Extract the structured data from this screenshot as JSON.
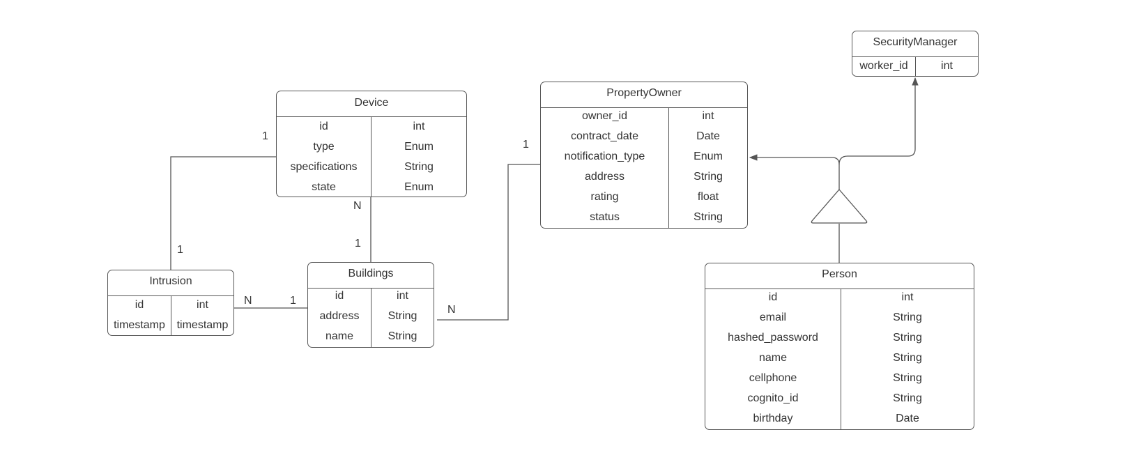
{
  "diagram": {
    "type": "entity-relationship",
    "line_color": "#555555",
    "text_color": "#333333",
    "entities": {
      "device": {
        "name": "Device",
        "attributes": [
          {
            "name": "id",
            "type": "int"
          },
          {
            "name": "type",
            "type": "Enum"
          },
          {
            "name": "specifications",
            "type": "String"
          },
          {
            "name": "state",
            "type": "Enum"
          }
        ]
      },
      "intrusion": {
        "name": "Intrusion",
        "attributes": [
          {
            "name": "id",
            "type": "int"
          },
          {
            "name": "timestamp",
            "type": "timestamp"
          }
        ]
      },
      "buildings": {
        "name": "Buildings",
        "attributes": [
          {
            "name": "id",
            "type": "int"
          },
          {
            "name": "address",
            "type": "String"
          },
          {
            "name": "name",
            "type": "String"
          }
        ]
      },
      "property_owner": {
        "name": "PropertyOwner",
        "attributes": [
          {
            "name": "owner_id",
            "type": "int"
          },
          {
            "name": "contract_date",
            "type": "Date"
          },
          {
            "name": "notification_type",
            "type": "Enum"
          },
          {
            "name": "address",
            "type": "String"
          },
          {
            "name": "rating",
            "type": "float"
          },
          {
            "name": "status",
            "type": "String"
          }
        ]
      },
      "security_manager": {
        "name": "SecurityManager",
        "attributes": [
          {
            "name": "worker_id",
            "type": "int"
          }
        ]
      },
      "person": {
        "name": "Person",
        "attributes": [
          {
            "name": "id",
            "type": "int"
          },
          {
            "name": "email",
            "type": "String"
          },
          {
            "name": "hashed_password",
            "type": "String"
          },
          {
            "name": "name",
            "type": "String"
          },
          {
            "name": "cellphone",
            "type": "String"
          },
          {
            "name": "cognito_id",
            "type": "String"
          },
          {
            "name": "birthday",
            "type": "Date"
          }
        ]
      }
    },
    "relationships": {
      "device_intrusion": {
        "from": "Device",
        "to": "Intrusion",
        "from_card": "1",
        "to_card": "1"
      },
      "device_buildings": {
        "from": "Device",
        "to": "Buildings",
        "from_card": "N",
        "to_card": "1"
      },
      "intrusion_buildings": {
        "from": "Intrusion",
        "to": "Buildings",
        "from_card": "N",
        "to_card": "1"
      },
      "buildings_owner": {
        "from": "Buildings",
        "to": "PropertyOwner",
        "from_card": "N",
        "to_card": "1"
      }
    },
    "inheritance": {
      "child": "Person",
      "parents": [
        "PropertyOwner",
        "SecurityManager"
      ]
    }
  }
}
